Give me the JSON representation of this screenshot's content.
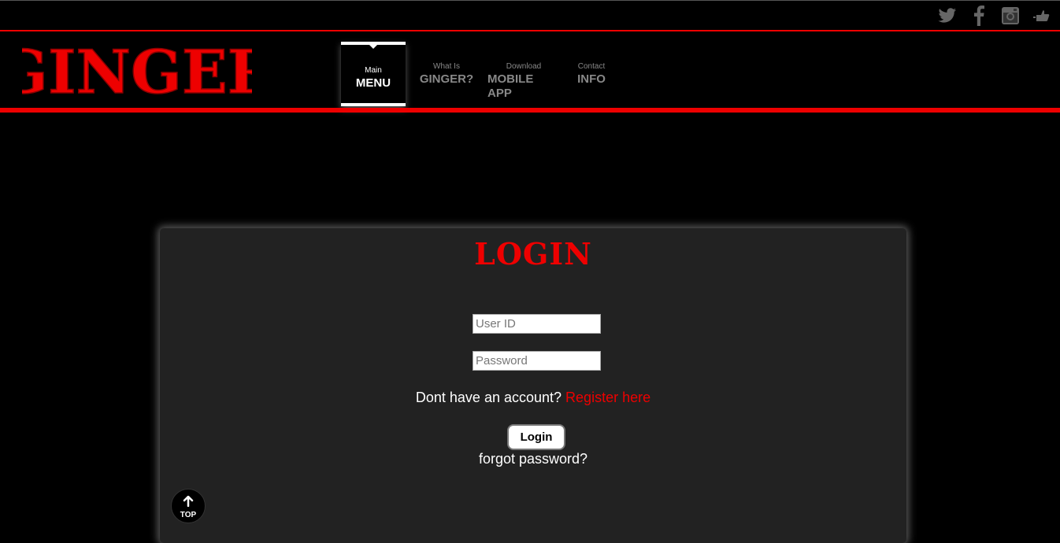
{
  "brand": {
    "logo_text": "GINGER",
    "accent_color": "#ee0000"
  },
  "social": [
    {
      "name": "twitter-icon"
    },
    {
      "name": "facebook-icon"
    },
    {
      "name": "instagram-icon"
    },
    {
      "name": "thumbs-up-icon"
    }
  ],
  "nav": {
    "items": [
      {
        "small": "Main",
        "big": "MENU",
        "active": true
      },
      {
        "small": "What Is",
        "big": "GINGER?"
      },
      {
        "small": "Download",
        "big": "MOBILE APP"
      },
      {
        "small": "Contact",
        "big": "INFO"
      }
    ]
  },
  "login": {
    "title": "LOGIN",
    "user_id_placeholder": "User ID",
    "password_placeholder": "Password",
    "register_prompt": "Dont have an account?",
    "register_link": "Register here",
    "button_label": "Login",
    "forgot_label": "forgot password?"
  },
  "scroll_top": {
    "label": "TOP"
  }
}
